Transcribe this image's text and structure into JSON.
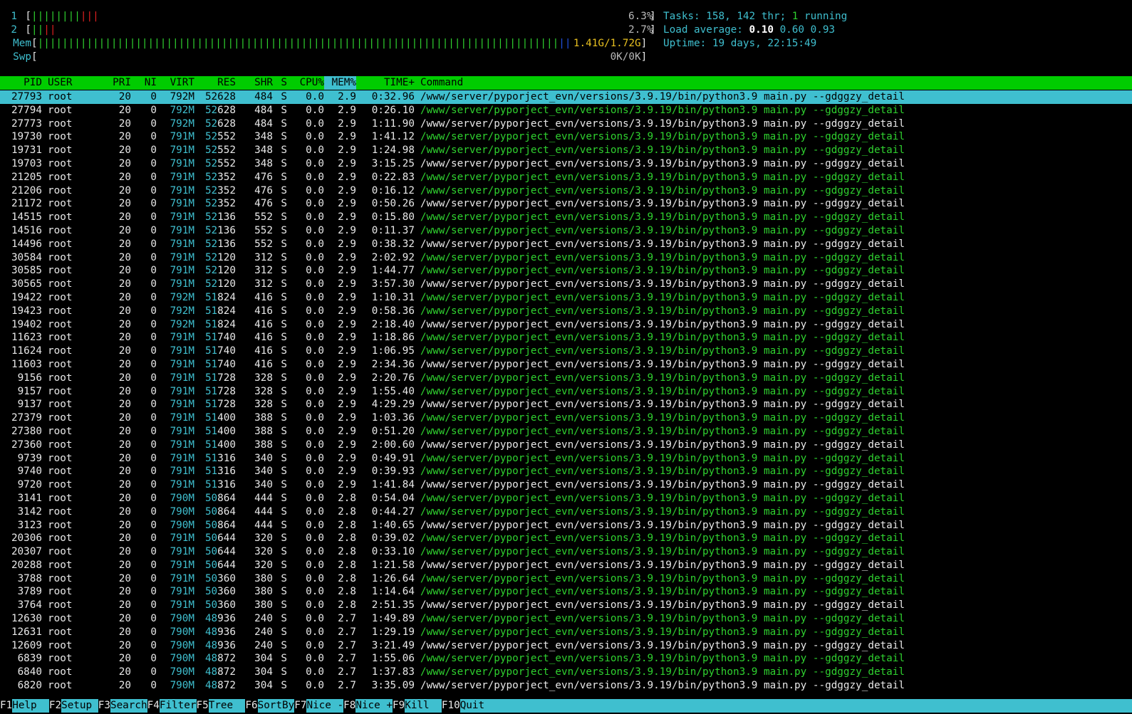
{
  "meters": {
    "cpu1": {
      "label": "1",
      "value": "6.3%",
      "green_bars": 8,
      "red_bars": 3
    },
    "cpu2": {
      "label": "2",
      "value": "2.7%",
      "green_bars": 2,
      "red_bars": 2
    },
    "mem": {
      "label": "Mem",
      "value": "1.41G/1.72G"
    },
    "swp": {
      "label": "Swp",
      "value": "0K/0K"
    }
  },
  "stats": {
    "tasks_label": "Tasks:",
    "tasks_count": "158,",
    "threads_count": "142",
    "threads_label": "thr;",
    "running_count": "1",
    "running_label": "running",
    "load_label": "Load average:",
    "load1": "0.10",
    "load5": "0.60",
    "load15": "0.93",
    "uptime_label": "Uptime:",
    "uptime_value": "19 days, 22:15:49"
  },
  "columns": {
    "pid": "PID",
    "user": "USER",
    "pri": "PRI",
    "ni": "NI",
    "virt": "VIRT",
    "res": "RES",
    "shr": "SHR",
    "s": "S",
    "cpu": "CPU%",
    "mem": "MEM%",
    "time": "TIME+",
    "command": "Command"
  },
  "command_text": "/www/server/pyporject_evn/versions/3.9.19/bin/python3.9 main.py --gdggzy_detail",
  "processes": [
    {
      "pid": "27793",
      "user": "root",
      "pri": "20",
      "ni": "0",
      "virt": "792M",
      "res": "52628",
      "shr": "484",
      "s": "S",
      "cpu": "0.0",
      "mem": "2.9",
      "time": "0:32.96",
      "thread": false,
      "selected": true
    },
    {
      "pid": "27794",
      "user": "root",
      "pri": "20",
      "ni": "0",
      "virt": "792M",
      "res": "52628",
      "shr": "484",
      "s": "S",
      "cpu": "0.0",
      "mem": "2.9",
      "time": "0:26.10",
      "thread": true
    },
    {
      "pid": "27773",
      "user": "root",
      "pri": "20",
      "ni": "0",
      "virt": "792M",
      "res": "52628",
      "shr": "484",
      "s": "S",
      "cpu": "0.0",
      "mem": "2.9",
      "time": "1:11.90",
      "thread": false
    },
    {
      "pid": "19730",
      "user": "root",
      "pri": "20",
      "ni": "0",
      "virt": "791M",
      "res": "52552",
      "shr": "348",
      "s": "S",
      "cpu": "0.0",
      "mem": "2.9",
      "time": "1:41.12",
      "thread": true
    },
    {
      "pid": "19731",
      "user": "root",
      "pri": "20",
      "ni": "0",
      "virt": "791M",
      "res": "52552",
      "shr": "348",
      "s": "S",
      "cpu": "0.0",
      "mem": "2.9",
      "time": "1:24.98",
      "thread": true
    },
    {
      "pid": "19703",
      "user": "root",
      "pri": "20",
      "ni": "0",
      "virt": "791M",
      "res": "52552",
      "shr": "348",
      "s": "S",
      "cpu": "0.0",
      "mem": "2.9",
      "time": "3:15.25",
      "thread": false
    },
    {
      "pid": "21205",
      "user": "root",
      "pri": "20",
      "ni": "0",
      "virt": "791M",
      "res": "52352",
      "shr": "476",
      "s": "S",
      "cpu": "0.0",
      "mem": "2.9",
      "time": "0:22.83",
      "thread": true
    },
    {
      "pid": "21206",
      "user": "root",
      "pri": "20",
      "ni": "0",
      "virt": "791M",
      "res": "52352",
      "shr": "476",
      "s": "S",
      "cpu": "0.0",
      "mem": "2.9",
      "time": "0:16.12",
      "thread": true
    },
    {
      "pid": "21172",
      "user": "root",
      "pri": "20",
      "ni": "0",
      "virt": "791M",
      "res": "52352",
      "shr": "476",
      "s": "S",
      "cpu": "0.0",
      "mem": "2.9",
      "time": "0:50.26",
      "thread": false
    },
    {
      "pid": "14515",
      "user": "root",
      "pri": "20",
      "ni": "0",
      "virt": "791M",
      "res": "52136",
      "shr": "552",
      "s": "S",
      "cpu": "0.0",
      "mem": "2.9",
      "time": "0:15.80",
      "thread": true
    },
    {
      "pid": "14516",
      "user": "root",
      "pri": "20",
      "ni": "0",
      "virt": "791M",
      "res": "52136",
      "shr": "552",
      "s": "S",
      "cpu": "0.0",
      "mem": "2.9",
      "time": "0:11.37",
      "thread": true
    },
    {
      "pid": "14496",
      "user": "root",
      "pri": "20",
      "ni": "0",
      "virt": "791M",
      "res": "52136",
      "shr": "552",
      "s": "S",
      "cpu": "0.0",
      "mem": "2.9",
      "time": "0:38.32",
      "thread": false
    },
    {
      "pid": "30584",
      "user": "root",
      "pri": "20",
      "ni": "0",
      "virt": "791M",
      "res": "52120",
      "shr": "312",
      "s": "S",
      "cpu": "0.0",
      "mem": "2.9",
      "time": "2:02.92",
      "thread": true
    },
    {
      "pid": "30585",
      "user": "root",
      "pri": "20",
      "ni": "0",
      "virt": "791M",
      "res": "52120",
      "shr": "312",
      "s": "S",
      "cpu": "0.0",
      "mem": "2.9",
      "time": "1:44.77",
      "thread": true
    },
    {
      "pid": "30565",
      "user": "root",
      "pri": "20",
      "ni": "0",
      "virt": "791M",
      "res": "52120",
      "shr": "312",
      "s": "S",
      "cpu": "0.0",
      "mem": "2.9",
      "time": "3:57.30",
      "thread": false
    },
    {
      "pid": "19422",
      "user": "root",
      "pri": "20",
      "ni": "0",
      "virt": "792M",
      "res": "51824",
      "shr": "416",
      "s": "S",
      "cpu": "0.0",
      "mem": "2.9",
      "time": "1:10.31",
      "thread": true
    },
    {
      "pid": "19423",
      "user": "root",
      "pri": "20",
      "ni": "0",
      "virt": "792M",
      "res": "51824",
      "shr": "416",
      "s": "S",
      "cpu": "0.0",
      "mem": "2.9",
      "time": "0:58.36",
      "thread": true
    },
    {
      "pid": "19402",
      "user": "root",
      "pri": "20",
      "ni": "0",
      "virt": "792M",
      "res": "51824",
      "shr": "416",
      "s": "S",
      "cpu": "0.0",
      "mem": "2.9",
      "time": "2:18.40",
      "thread": false
    },
    {
      "pid": "11623",
      "user": "root",
      "pri": "20",
      "ni": "0",
      "virt": "791M",
      "res": "51740",
      "shr": "416",
      "s": "S",
      "cpu": "0.0",
      "mem": "2.9",
      "time": "1:18.86",
      "thread": true
    },
    {
      "pid": "11624",
      "user": "root",
      "pri": "20",
      "ni": "0",
      "virt": "791M",
      "res": "51740",
      "shr": "416",
      "s": "S",
      "cpu": "0.0",
      "mem": "2.9",
      "time": "1:06.95",
      "thread": true
    },
    {
      "pid": "11603",
      "user": "root",
      "pri": "20",
      "ni": "0",
      "virt": "791M",
      "res": "51740",
      "shr": "416",
      "s": "S",
      "cpu": "0.0",
      "mem": "2.9",
      "time": "2:34.36",
      "thread": false
    },
    {
      "pid": "9156",
      "user": "root",
      "pri": "20",
      "ni": "0",
      "virt": "791M",
      "res": "51728",
      "shr": "328",
      "s": "S",
      "cpu": "0.0",
      "mem": "2.9",
      "time": "2:20.76",
      "thread": true
    },
    {
      "pid": "9157",
      "user": "root",
      "pri": "20",
      "ni": "0",
      "virt": "791M",
      "res": "51728",
      "shr": "328",
      "s": "S",
      "cpu": "0.0",
      "mem": "2.9",
      "time": "1:55.40",
      "thread": true
    },
    {
      "pid": "9137",
      "user": "root",
      "pri": "20",
      "ni": "0",
      "virt": "791M",
      "res": "51728",
      "shr": "328",
      "s": "S",
      "cpu": "0.0",
      "mem": "2.9",
      "time": "4:29.29",
      "thread": false
    },
    {
      "pid": "27379",
      "user": "root",
      "pri": "20",
      "ni": "0",
      "virt": "791M",
      "res": "51400",
      "shr": "388",
      "s": "S",
      "cpu": "0.0",
      "mem": "2.9",
      "time": "1:03.36",
      "thread": true
    },
    {
      "pid": "27380",
      "user": "root",
      "pri": "20",
      "ni": "0",
      "virt": "791M",
      "res": "51400",
      "shr": "388",
      "s": "S",
      "cpu": "0.0",
      "mem": "2.9",
      "time": "0:51.20",
      "thread": true
    },
    {
      "pid": "27360",
      "user": "root",
      "pri": "20",
      "ni": "0",
      "virt": "791M",
      "res": "51400",
      "shr": "388",
      "s": "S",
      "cpu": "0.0",
      "mem": "2.9",
      "time": "2:00.60",
      "thread": false
    },
    {
      "pid": "9739",
      "user": "root",
      "pri": "20",
      "ni": "0",
      "virt": "791M",
      "res": "51316",
      "shr": "340",
      "s": "S",
      "cpu": "0.0",
      "mem": "2.9",
      "time": "0:49.91",
      "thread": true
    },
    {
      "pid": "9740",
      "user": "root",
      "pri": "20",
      "ni": "0",
      "virt": "791M",
      "res": "51316",
      "shr": "340",
      "s": "S",
      "cpu": "0.0",
      "mem": "2.9",
      "time": "0:39.93",
      "thread": true
    },
    {
      "pid": "9720",
      "user": "root",
      "pri": "20",
      "ni": "0",
      "virt": "791M",
      "res": "51316",
      "shr": "340",
      "s": "S",
      "cpu": "0.0",
      "mem": "2.9",
      "time": "1:41.84",
      "thread": false
    },
    {
      "pid": "3141",
      "user": "root",
      "pri": "20",
      "ni": "0",
      "virt": "790M",
      "res": "50864",
      "shr": "444",
      "s": "S",
      "cpu": "0.0",
      "mem": "2.8",
      "time": "0:54.04",
      "thread": true
    },
    {
      "pid": "3142",
      "user": "root",
      "pri": "20",
      "ni": "0",
      "virt": "790M",
      "res": "50864",
      "shr": "444",
      "s": "S",
      "cpu": "0.0",
      "mem": "2.8",
      "time": "0:44.27",
      "thread": true
    },
    {
      "pid": "3123",
      "user": "root",
      "pri": "20",
      "ni": "0",
      "virt": "790M",
      "res": "50864",
      "shr": "444",
      "s": "S",
      "cpu": "0.0",
      "mem": "2.8",
      "time": "1:40.65",
      "thread": false
    },
    {
      "pid": "20306",
      "user": "root",
      "pri": "20",
      "ni": "0",
      "virt": "791M",
      "res": "50644",
      "shr": "320",
      "s": "S",
      "cpu": "0.0",
      "mem": "2.8",
      "time": "0:39.02",
      "thread": true
    },
    {
      "pid": "20307",
      "user": "root",
      "pri": "20",
      "ni": "0",
      "virt": "791M",
      "res": "50644",
      "shr": "320",
      "s": "S",
      "cpu": "0.0",
      "mem": "2.8",
      "time": "0:33.10",
      "thread": true
    },
    {
      "pid": "20288",
      "user": "root",
      "pri": "20",
      "ni": "0",
      "virt": "791M",
      "res": "50644",
      "shr": "320",
      "s": "S",
      "cpu": "0.0",
      "mem": "2.8",
      "time": "1:21.58",
      "thread": false
    },
    {
      "pid": "3788",
      "user": "root",
      "pri": "20",
      "ni": "0",
      "virt": "791M",
      "res": "50360",
      "shr": "380",
      "s": "S",
      "cpu": "0.0",
      "mem": "2.8",
      "time": "1:26.64",
      "thread": true
    },
    {
      "pid": "3789",
      "user": "root",
      "pri": "20",
      "ni": "0",
      "virt": "791M",
      "res": "50360",
      "shr": "380",
      "s": "S",
      "cpu": "0.0",
      "mem": "2.8",
      "time": "1:14.64",
      "thread": true
    },
    {
      "pid": "3764",
      "user": "root",
      "pri": "20",
      "ni": "0",
      "virt": "791M",
      "res": "50360",
      "shr": "380",
      "s": "S",
      "cpu": "0.0",
      "mem": "2.8",
      "time": "2:51.35",
      "thread": false
    },
    {
      "pid": "12630",
      "user": "root",
      "pri": "20",
      "ni": "0",
      "virt": "790M",
      "res": "48936",
      "shr": "240",
      "s": "S",
      "cpu": "0.0",
      "mem": "2.7",
      "time": "1:49.89",
      "thread": true
    },
    {
      "pid": "12631",
      "user": "root",
      "pri": "20",
      "ni": "0",
      "virt": "790M",
      "res": "48936",
      "shr": "240",
      "s": "S",
      "cpu": "0.0",
      "mem": "2.7",
      "time": "1:29.19",
      "thread": true
    },
    {
      "pid": "12609",
      "user": "root",
      "pri": "20",
      "ni": "0",
      "virt": "790M",
      "res": "48936",
      "shr": "240",
      "s": "S",
      "cpu": "0.0",
      "mem": "2.7",
      "time": "3:21.49",
      "thread": false
    },
    {
      "pid": "6839",
      "user": "root",
      "pri": "20",
      "ni": "0",
      "virt": "790M",
      "res": "48872",
      "shr": "304",
      "s": "S",
      "cpu": "0.0",
      "mem": "2.7",
      "time": "1:55.06",
      "thread": true
    },
    {
      "pid": "6840",
      "user": "root",
      "pri": "20",
      "ni": "0",
      "virt": "790M",
      "res": "48872",
      "shr": "304",
      "s": "S",
      "cpu": "0.0",
      "mem": "2.7",
      "time": "1:37.83",
      "thread": true
    },
    {
      "pid": "6820",
      "user": "root",
      "pri": "20",
      "ni": "0",
      "virt": "790M",
      "res": "48872",
      "shr": "304",
      "s": "S",
      "cpu": "0.0",
      "mem": "2.7",
      "time": "3:35.09",
      "thread": false
    }
  ],
  "footer": [
    {
      "key": "F1",
      "label": "Help  "
    },
    {
      "key": "F2",
      "label": "Setup "
    },
    {
      "key": "F3",
      "label": "Search"
    },
    {
      "key": "F4",
      "label": "Filter"
    },
    {
      "key": "F5",
      "label": "Tree  "
    },
    {
      "key": "F6",
      "label": "SortBy"
    },
    {
      "key": "F7",
      "label": "Nice -"
    },
    {
      "key": "F8",
      "label": "Nice +"
    },
    {
      "key": "F9",
      "label": "Kill  "
    },
    {
      "key": "F10",
      "label": "Quit"
    }
  ],
  "colors": {
    "background": "#000000",
    "header_bg": "#00cc00",
    "selected_bg": "#3fbfcf",
    "thread_cmd": "#2fd12f",
    "cyan": "#3fbfcf"
  }
}
